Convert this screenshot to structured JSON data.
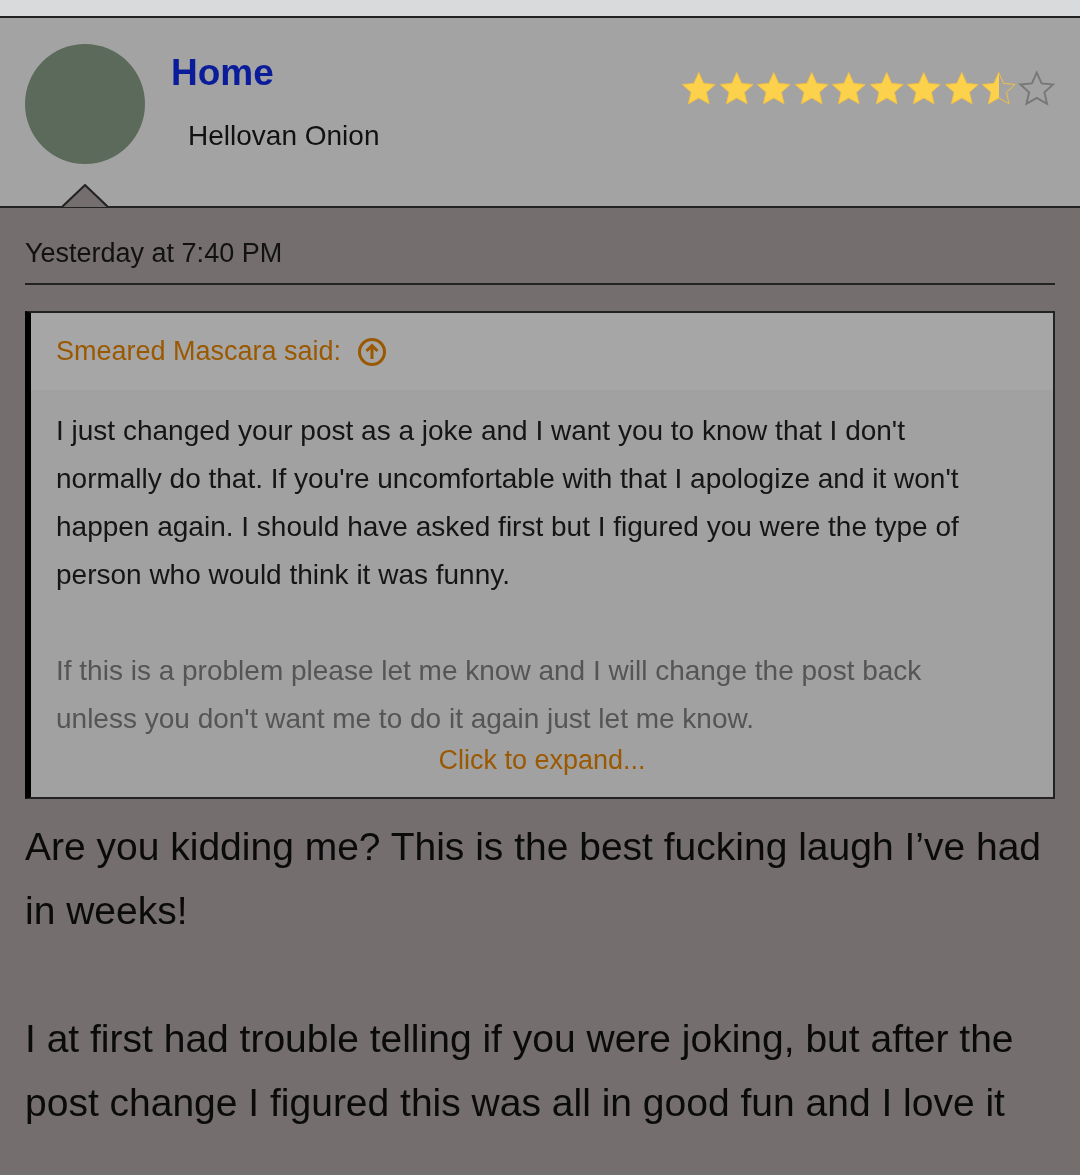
{
  "header": {
    "title": "Home",
    "username": "Hellovan Onion",
    "rating": {
      "stars": 8.5
    }
  },
  "post": {
    "timestamp": "Yesterday at 7:40 PM",
    "quote": {
      "author": "Smeared Mascara said:",
      "paragraphs": [
        "I just changed your post as a joke and I want you to know that I don't normally do that. If you're uncomfortable with that I apologize and it won't happen again. I should have asked first but I figured you were the type of person who would think it was funny.",
        "If this is a problem please let me know and I will change the post back unless you don't want me to do it again just let me know."
      ],
      "expand_link": "Click to expand..."
    },
    "paragraphs": [
      "Are you kidding me? This is the best fucking laugh I’ve had in weeks!",
      "I at first had trouble telling if you were joking, but after the post change I figured this was all in good fun and I love it"
    ]
  }
}
